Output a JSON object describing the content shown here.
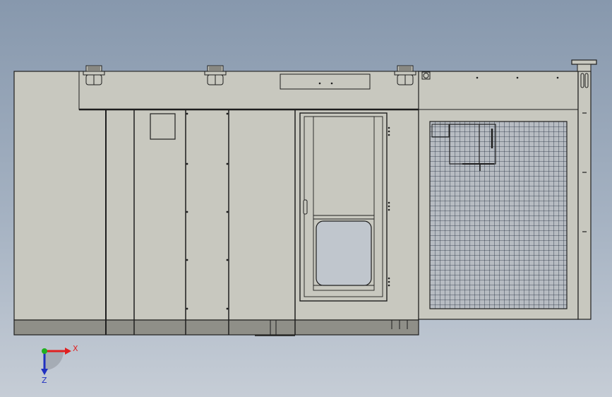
{
  "colors": {
    "panel_fill": "#c8c8bf",
    "base_fill": "#8f8f88",
    "outline": "#1e1e1e",
    "mesh": "#1e2a3a",
    "glass": "#c0c6cd",
    "axis_x": "#e02020",
    "axis_y": "#20b020",
    "axis_z": "#2030c0"
  },
  "triad": {
    "x_label": "X",
    "z_label": "Z"
  },
  "icons": {
    "roof_fittings": "vent-flange-icon",
    "triad": "coordinate-triad-icon"
  }
}
